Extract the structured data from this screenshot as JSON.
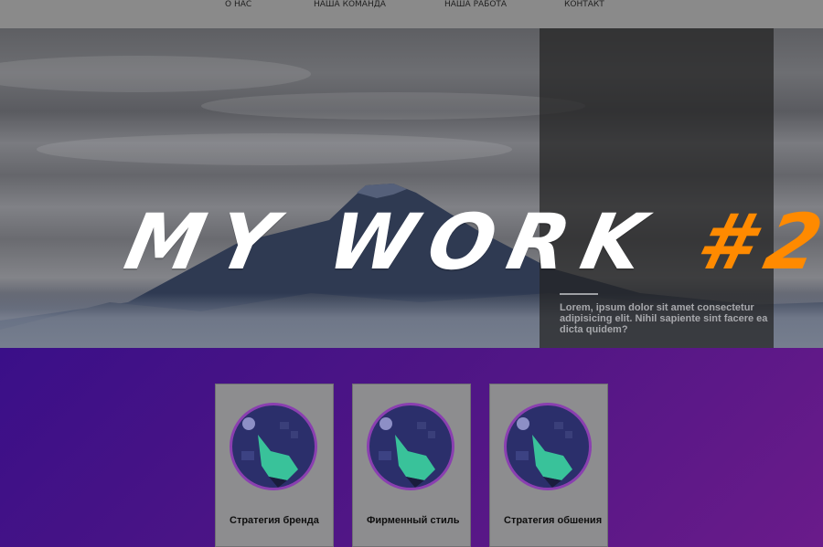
{
  "nav": {
    "items": [
      {
        "label": "О НАС"
      },
      {
        "label": "НАША КОМАНДА"
      },
      {
        "label": "НАША РАБОТА"
      },
      {
        "label": "КОНТАКТ"
      }
    ]
  },
  "hero": {
    "title_main": "MY WORK",
    "title_number": "#2",
    "panel_text": "Lorem, ipsum dolor sit amet consectetur adipisicing elit. Nihil sapiente sint facere ea dicta quidem?"
  },
  "cards": [
    {
      "title": "Стратегия бренда"
    },
    {
      "title": "Фирменный стиль"
    },
    {
      "title": "Стратегия обшения"
    }
  ],
  "colors": {
    "accent": "#ff8a00",
    "services_bg": "#4d1585",
    "card_bg": "#8d8d8f"
  }
}
